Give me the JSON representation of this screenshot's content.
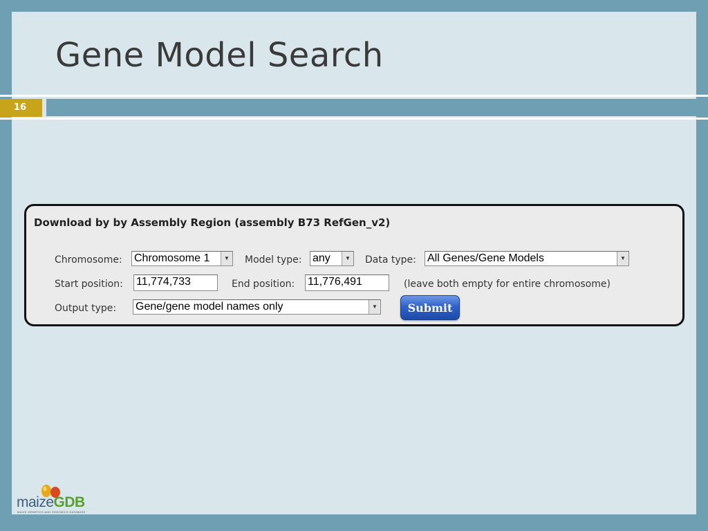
{
  "slide": {
    "title": "Gene Model Search",
    "number": "16"
  },
  "form": {
    "heading": "Download by by Assembly Region (assembly B73 RefGen_v2)",
    "chromosome_label": "Chromosome:",
    "chromosome_value": "Chromosome 1",
    "model_type_label": "Model type:",
    "model_type_value": "any",
    "data_type_label": "Data type:",
    "data_type_value": "All Genes/Gene Models",
    "start_label": "Start position:",
    "start_value": "11,774,733",
    "end_label": "End position:",
    "end_value": "11,776,491",
    "hint": "(leave both empty for entire chromosome)",
    "output_label": "Output type:",
    "output_value": "Gene/gene model names only",
    "submit_label": "Submit"
  },
  "logo": {
    "maize": "maize",
    "gdb": "GDB",
    "tagline": "MAIZE GENETICS AND GENOMICS DATABASE"
  },
  "colors": {
    "frame": "#6f9fb2",
    "slide_bg": "#d9e6eb",
    "number_badge": "#c8a41a",
    "submit_button": "#2f62c9"
  },
  "icons": {
    "dropdown": "chevron-down-icon",
    "logo": "maize-kernel-icon"
  }
}
